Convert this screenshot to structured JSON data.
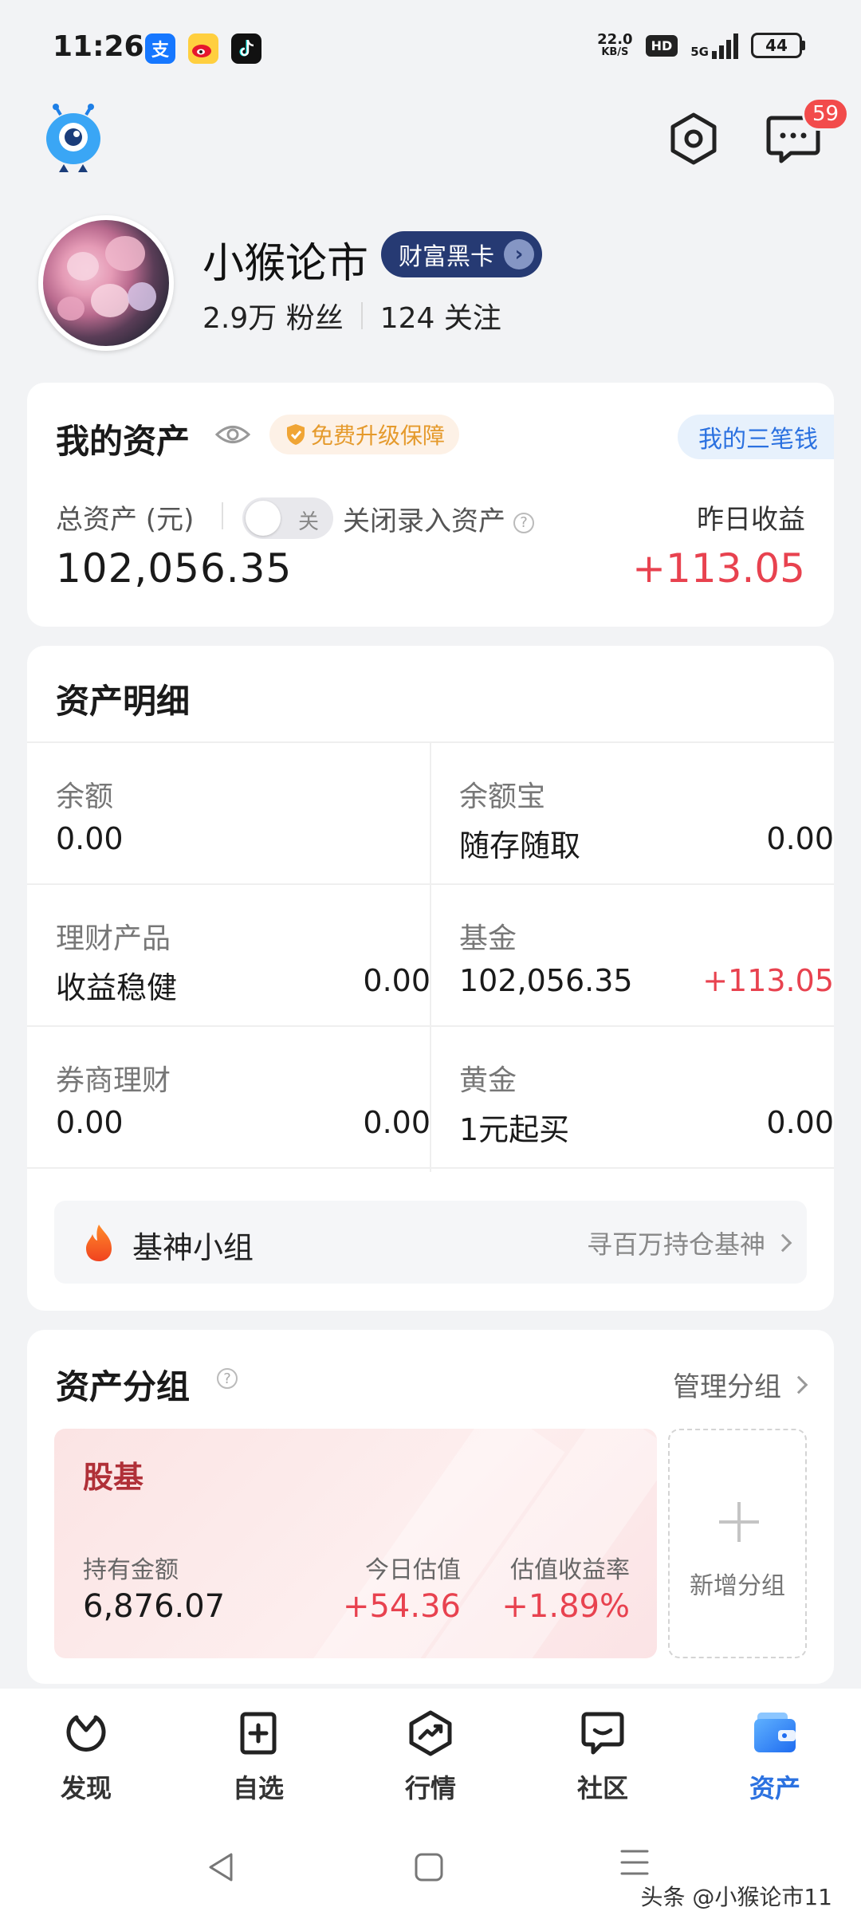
{
  "status_bar": {
    "time": "11:26",
    "net_speed_value": "22.0",
    "net_speed_unit": "KB/S",
    "hd": "HD",
    "network": "5G",
    "battery": "44"
  },
  "header": {
    "message_badge": "59"
  },
  "profile": {
    "name": "小猴论市",
    "vip_label": "财富黑卡",
    "fans": "2.9万 粉丝",
    "following": "124 关注"
  },
  "assets": {
    "title": "我的资产",
    "guarantee_label": "免费升级保障",
    "three_money_label": "我的三笔钱",
    "total_label": "总资产 (元)",
    "toggle_label": "关",
    "close_entry_label": "关闭录入资产",
    "yesterday_label": "昨日收益",
    "total_value": "102,056.35",
    "yesterday_value": "+113.05"
  },
  "detail": {
    "title": "资产明细",
    "cells": [
      {
        "label": "余额",
        "sub": "0.00",
        "value": ""
      },
      {
        "label": "余额宝",
        "sub": "随存随取",
        "value": "0.00"
      },
      {
        "label": "理财产品",
        "sub": "收益稳健",
        "value": "0.00"
      },
      {
        "label": "基金",
        "sub": "102,056.35",
        "value": "+113.05"
      },
      {
        "label": "券商理财",
        "sub": "0.00",
        "value": "0.00"
      },
      {
        "label": "黄金",
        "sub": "1元起买",
        "value": "0.00"
      }
    ],
    "group_bar_label": "基神小组",
    "group_bar_hint": "寻百万持仓基神"
  },
  "groups": {
    "title": "资产分组",
    "manage_label": "管理分组",
    "card": {
      "name": "股基",
      "hold_label": "持有金额",
      "hold_value": "6,876.07",
      "today_label": "今日估值",
      "today_value": "+54.36",
      "rate_label": "估值收益率",
      "rate_value": "+1.89%"
    },
    "add_label": "新增分组"
  },
  "bottom_nav": {
    "tabs": [
      {
        "label": "发现",
        "icon": "discover-icon"
      },
      {
        "label": "自选",
        "icon": "watchlist-icon"
      },
      {
        "label": "行情",
        "icon": "market-icon"
      },
      {
        "label": "社区",
        "icon": "community-icon"
      },
      {
        "label": "资产",
        "icon": "wallet-icon"
      }
    ],
    "active": "资产"
  },
  "watermark": "头条 @小猴论市11",
  "colors": {
    "accent": "#2b71e0",
    "positive": "#e8424f",
    "vip_bg": "#263a73"
  }
}
